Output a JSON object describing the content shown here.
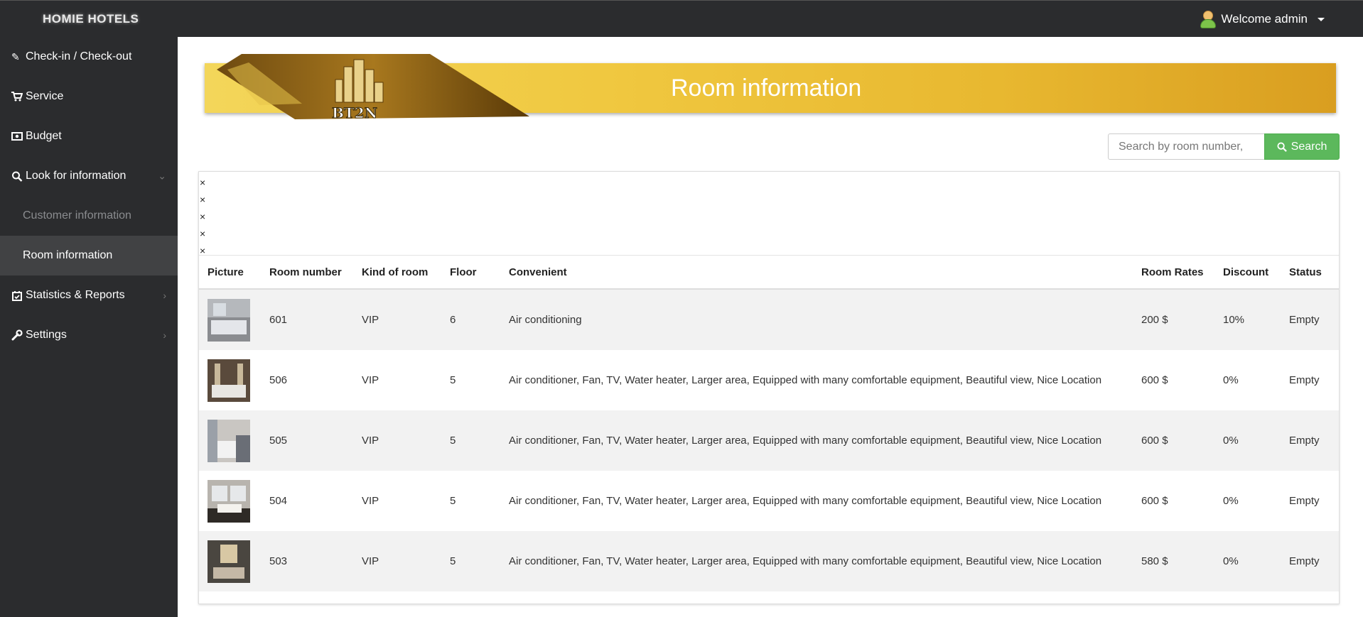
{
  "app": {
    "brand": "HOMIE HOTELS",
    "user_label": "Welcome admin"
  },
  "sidebar": {
    "items": [
      {
        "label": "Check-in / Check-out",
        "icon": "edit-icon"
      },
      {
        "label": "Service",
        "icon": "cart-icon"
      },
      {
        "label": "Budget",
        "icon": "money-icon"
      },
      {
        "label": "Look for information",
        "icon": "search-icon"
      },
      {
        "label": "Statistics & Reports",
        "icon": "calendar-check-icon"
      },
      {
        "label": "Settings",
        "icon": "wrench-icon"
      }
    ],
    "subitems": [
      {
        "label": "Customer information"
      },
      {
        "label": "Room information",
        "active": true
      }
    ]
  },
  "banner": {
    "title": "Room information",
    "logo_text": "BT2N"
  },
  "search": {
    "placeholder": "Search by room number,",
    "button_label": "Search"
  },
  "panel": {
    "close_marks": [
      "×",
      "×",
      "×",
      "×",
      "×"
    ]
  },
  "table": {
    "headers": [
      "Picture",
      "Room number",
      "Kind of room",
      "Floor",
      "Convenient",
      "Room Rates",
      "Discount",
      "Status"
    ],
    "rows": [
      {
        "room": "601",
        "kind": "VIP",
        "floor": "6",
        "convenient": "Air conditioning",
        "rate": "200 $",
        "discount": "10%",
        "status": "Empty"
      },
      {
        "room": "506",
        "kind": "VIP",
        "floor": "5",
        "convenient": "Air conditioner, Fan, TV, Water heater, Larger area, Equipped with many comfortable equipment, Beautiful view, Nice Location",
        "rate": "600 $",
        "discount": "0%",
        "status": "Empty"
      },
      {
        "room": "505",
        "kind": "VIP",
        "floor": "5",
        "convenient": "Air conditioner, Fan, TV, Water heater, Larger area, Equipped with many comfortable equipment, Beautiful view, Nice Location",
        "rate": "600 $",
        "discount": "0%",
        "status": "Empty"
      },
      {
        "room": "504",
        "kind": "VIP",
        "floor": "5",
        "convenient": "Air conditioner, Fan, TV, Water heater, Larger area, Equipped with many comfortable equipment, Beautiful view, Nice Location",
        "rate": "600 $",
        "discount": "0%",
        "status": "Empty"
      },
      {
        "room": "503",
        "kind": "VIP",
        "floor": "5",
        "convenient": "Air conditioner, Fan, TV, Water heater, Larger area, Equipped with many comfortable equipment, Beautiful view, Nice Location",
        "rate": "580 $",
        "discount": "0%",
        "status": "Empty"
      }
    ]
  },
  "colors": {
    "sidebar_bg": "#2b2c2e",
    "active_item_bg": "#414244",
    "search_button": "#5cb85c",
    "banner_gold": "#f0c840"
  }
}
